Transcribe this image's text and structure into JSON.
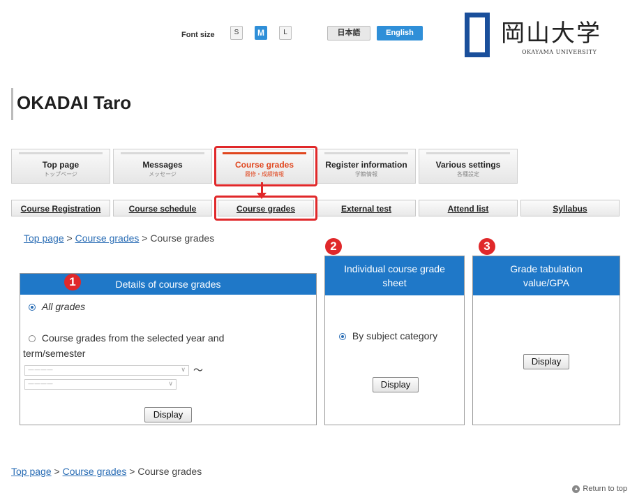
{
  "header": {
    "font_size_label": "Font size",
    "font_sizes": [
      "S",
      "M",
      "L"
    ],
    "font_size_selected": "M",
    "languages": [
      "日本語",
      "English"
    ],
    "language_selected": "English",
    "logo_kanji": "岡山大学",
    "logo_en": "OKAYAMA UNIVERSITY",
    "logo_color": "#1a4f9b"
  },
  "user": {
    "name": "OKADAI Taro"
  },
  "main_nav": [
    {
      "en": "Top page",
      "jp": "トップページ"
    },
    {
      "en": "Messages",
      "jp": "メッセージ"
    },
    {
      "en": "Course grades",
      "jp": "履修・成績情報",
      "active": true
    },
    {
      "en": "Register information",
      "jp": "学籍情報"
    },
    {
      "en": "Various settings",
      "jp": "各種設定"
    }
  ],
  "sub_nav": [
    "Course Registration",
    "Course schedule",
    "Course grades",
    "External test",
    "Attend list",
    "Syllabus"
  ],
  "breadcrumb": {
    "items": [
      "Top page",
      "Course grades"
    ],
    "current": "Course grades",
    "sep": ">"
  },
  "panels": {
    "details": {
      "badge": "1",
      "title": "Details of course grades",
      "option_all": "All grades",
      "option_selected_year_1": "Course grades from the selected year and",
      "option_selected_year_2": "term/semester",
      "select_placeholder": "————",
      "tilde": "～",
      "button": "Display"
    },
    "individual": {
      "badge": "2",
      "title_1": "Individual course grade",
      "title_2": "sheet",
      "option": "By subject category",
      "button": "Display"
    },
    "gpa": {
      "badge": "3",
      "title_1": "Grade tabulation",
      "title_2": "value/GPA",
      "button": "Display"
    }
  },
  "footer": {
    "return_label": "Return to top"
  },
  "colors": {
    "accent_blue": "#1f78c8",
    "highlight_red": "#e0282a",
    "active_tab": "#e0471f"
  }
}
